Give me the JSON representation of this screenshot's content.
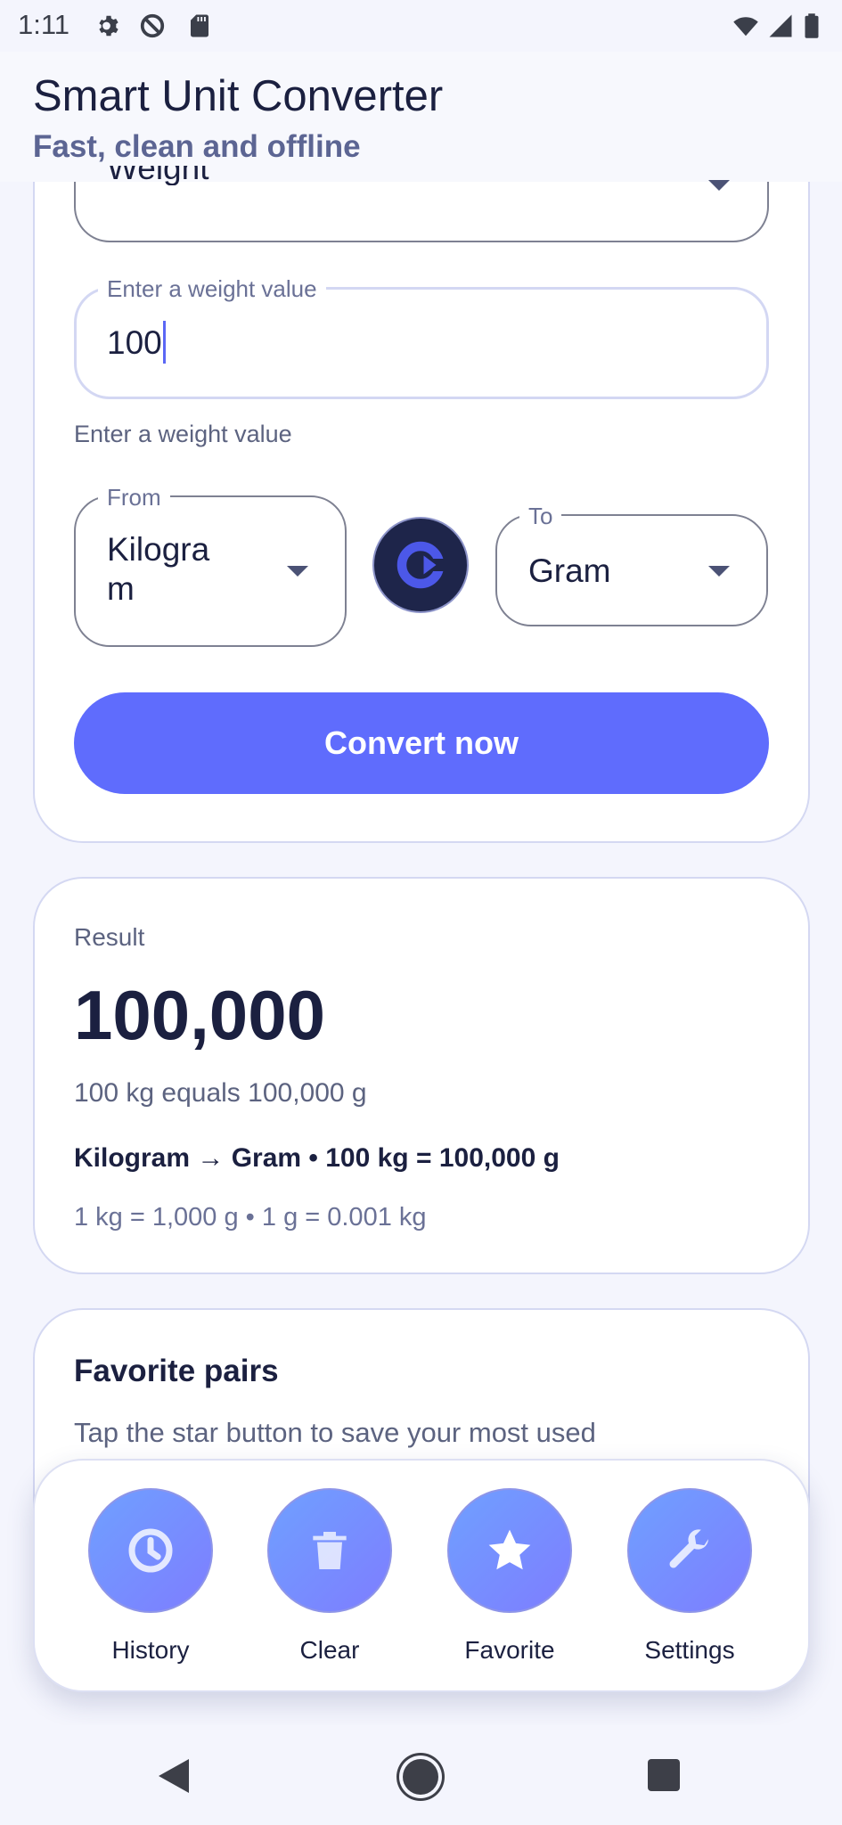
{
  "status_bar": {
    "time": "1:11",
    "icons": [
      "settings-icon",
      "data-saver-icon",
      "sd-card-icon",
      "wifi-icon",
      "signal-icon",
      "battery-icon"
    ]
  },
  "app_bar": {
    "title": "Smart Unit Converter",
    "subtitle": "Fast, clean and offline"
  },
  "converter": {
    "category_value": "Weight",
    "input_label": "Enter a weight value",
    "input_value": "100",
    "helper_text": "Enter a weight value",
    "from_label": "From",
    "from_value": "Kilogra\nm",
    "to_label": "To",
    "to_value": "Gram",
    "swap_icon": "swap-icon",
    "convert_label": "Convert now"
  },
  "result": {
    "label": "Result",
    "value": "100,000",
    "description": "100 kg equals 100,000 g",
    "formula": "Kilogram → Gram • 100 kg = 100,000 g",
    "ratio": "1 kg = 1,000 g • 1 g = 0.001 kg"
  },
  "favorites": {
    "title": "Favorite pairs",
    "text": "Tap the star button to save your most used"
  },
  "actions": [
    {
      "label": "History",
      "icon": "history-icon"
    },
    {
      "label": "Clear",
      "icon": "trash-icon"
    },
    {
      "label": "Favorite",
      "icon": "star-icon"
    },
    {
      "label": "Settings",
      "icon": "wrench-icon"
    }
  ],
  "colors": {
    "accent": "#5f6cfd",
    "dark": "#1e254a",
    "background": "#f4f5fd"
  }
}
